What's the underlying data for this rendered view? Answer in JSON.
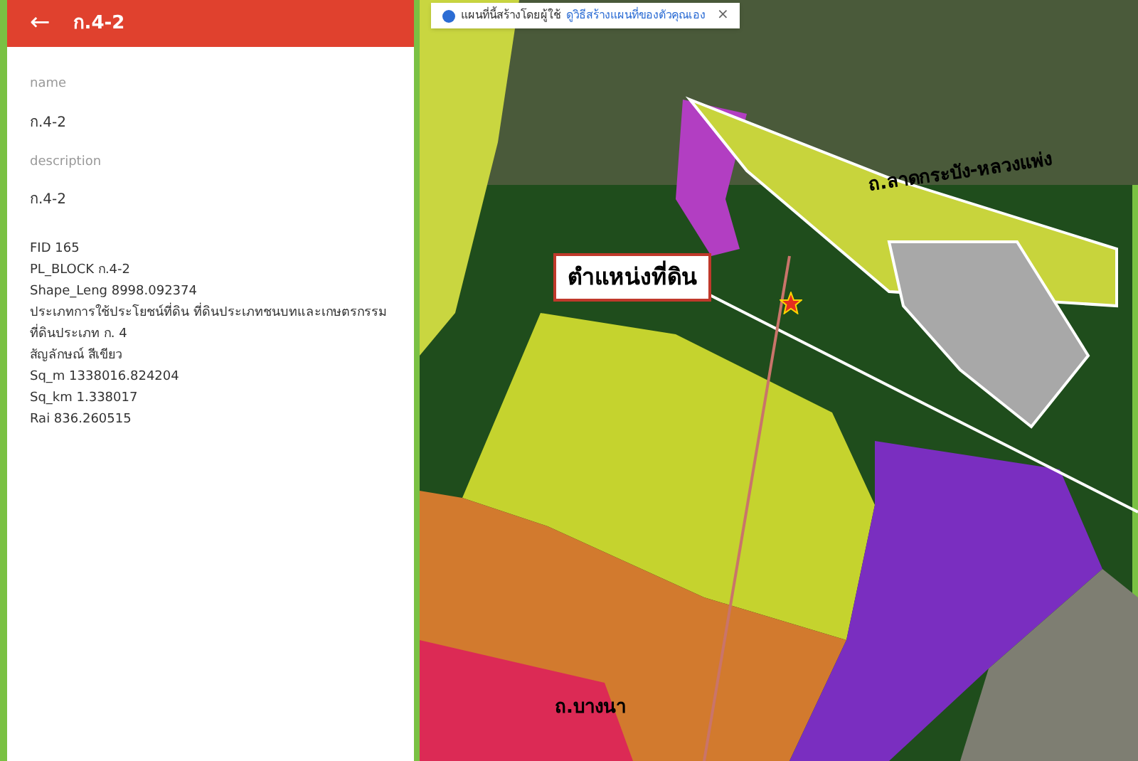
{
  "header": {
    "back": "←",
    "title": "ก.4-2"
  },
  "fields": [
    {
      "label": "name",
      "value": "ก.4-2"
    },
    {
      "label": "description",
      "value": "ก.4-2"
    }
  ],
  "attributes": [
    "FID 165",
    "PL_BLOCK ก.4-2",
    "Shape_Leng 8998.092374",
    "ประเภทการใช้ประโยชน์ที่ดิน ที่ดินประเภทชนบทและเกษตรกรรม",
    "ที่ดินประเภท ก. 4",
    "สัญลักษณ์ สีเขียว",
    "Sq_m 1338016.824204",
    "Sq_km 1.338017",
    "Rai 836.260515"
  ],
  "map": {
    "notice": {
      "text": "แผนที่นี้สร้างโดยผู้ใช้",
      "link": "ดูวิธีสร้างแผนที่ของตัวคุณเอง",
      "close": "×"
    },
    "callout": "ตำแหน่งที่ดิน",
    "road_labels": [
      "ถ.ลาดกระบัง-หลวงแพ่ง",
      "ถ.บางนา"
    ]
  }
}
